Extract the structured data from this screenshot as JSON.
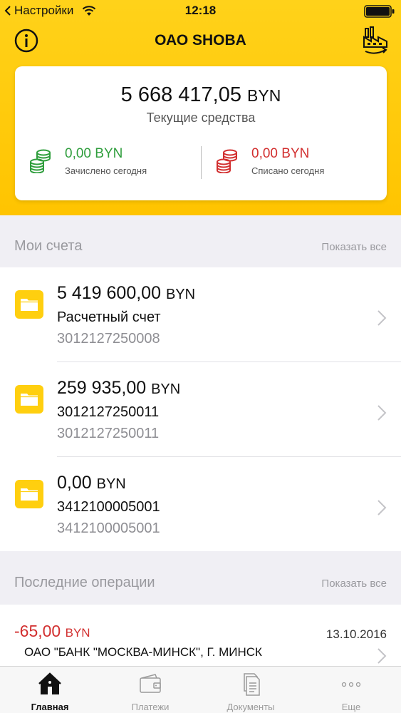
{
  "status_bar": {
    "back_app": "Настройки",
    "time": "12:18"
  },
  "header": {
    "title": "ОАО SHOBA"
  },
  "balance": {
    "amount": "5 668 417,05",
    "currency": "BYN",
    "label": "Текущие средства",
    "credited": {
      "amount": "0,00",
      "currency": "BYN",
      "label": "Зачислено сегодня"
    },
    "debited": {
      "amount": "0,00",
      "currency": "BYN",
      "label": "Списано сегодня"
    }
  },
  "accounts_section": {
    "title": "Мои счета",
    "show_all": "Показать все"
  },
  "accounts": [
    {
      "amount": "5 419 600,00",
      "currency": "BYN",
      "name": "Расчетный счет",
      "number": "3012127250008"
    },
    {
      "amount": "259 935,00",
      "currency": "BYN",
      "name": "3012127250011",
      "number": "3012127250011"
    },
    {
      "amount": "0,00",
      "currency": "BYN",
      "name": "3412100005001",
      "number": "3412100005001"
    }
  ],
  "operations_section": {
    "title": "Последние операции",
    "show_all": "Показать все"
  },
  "operations": [
    {
      "amount": "-65,00",
      "currency": "BYN",
      "date": "13.10.2016",
      "description": "ОАО \"БАНК \"МОСКВА-МИНСК\", Г. МИНСК"
    }
  ],
  "tabs": [
    {
      "label": "Главная",
      "icon": "home-icon",
      "active": true
    },
    {
      "label": "Платежи",
      "icon": "wallet-icon",
      "active": false
    },
    {
      "label": "Документы",
      "icon": "documents-icon",
      "active": false
    },
    {
      "label": "Еще",
      "icon": "more-icon",
      "active": false
    }
  ],
  "colors": {
    "accent": "#ffc400",
    "income": "#2f9e3d",
    "expense": "#d22f2f",
    "muted": "#9a9a9f"
  }
}
